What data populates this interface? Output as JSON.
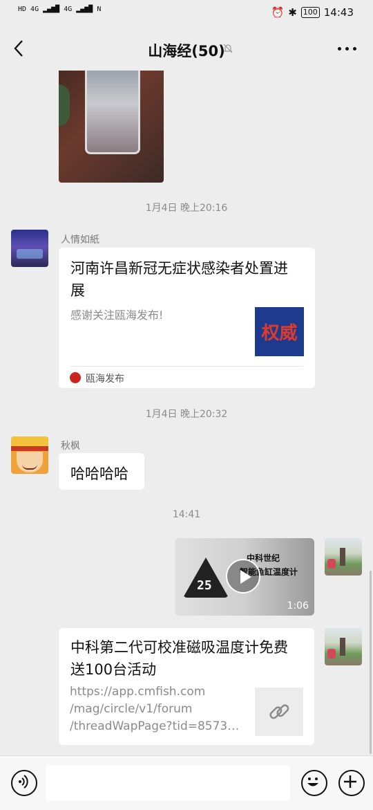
{
  "status_bar": {
    "left_labels": [
      "HD",
      "4G",
      "4G",
      "N"
    ],
    "battery": "100",
    "time": "14:43"
  },
  "header": {
    "title": "山海经(50)"
  },
  "messages": {
    "ts1": "1月4日 晚上20:16",
    "card1": {
      "sender": "人情如紙",
      "title": "河南许昌新冠无症状感染者处置进展",
      "desc": "感谢关注瓯海发布!",
      "thumb_text": "权威",
      "source": "瓯海发布"
    },
    "ts2": "1月4日 晚上20:32",
    "msg2": {
      "sender": "秋枫",
      "text": "哈哈哈哈"
    },
    "ts3": "14:41",
    "video": {
      "title_line1": "中科世纪",
      "title_line2": "智能鱼缸温度计",
      "reading": "25",
      "duration": "1:06"
    },
    "link": {
      "title": "中科第二代可校准磁吸温度计免费送100台活动",
      "url_lines": [
        "https://app.cmfish.com",
        "/mag/circle/v1/forum",
        "/threadWapPage?tid=8573…"
      ]
    }
  },
  "colors": {
    "background": "#ededed",
    "bubble": "#ffffff",
    "timestamp": "#8a8a8a",
    "thumb_blue": "#1d3a8f",
    "thumb_red": "#e03a2b"
  },
  "icons": [
    "back-arrow-icon",
    "mute-bell-icon",
    "more-icon",
    "voice-icon",
    "emoji-icon",
    "plus-icon",
    "play-icon",
    "link-icon"
  ]
}
